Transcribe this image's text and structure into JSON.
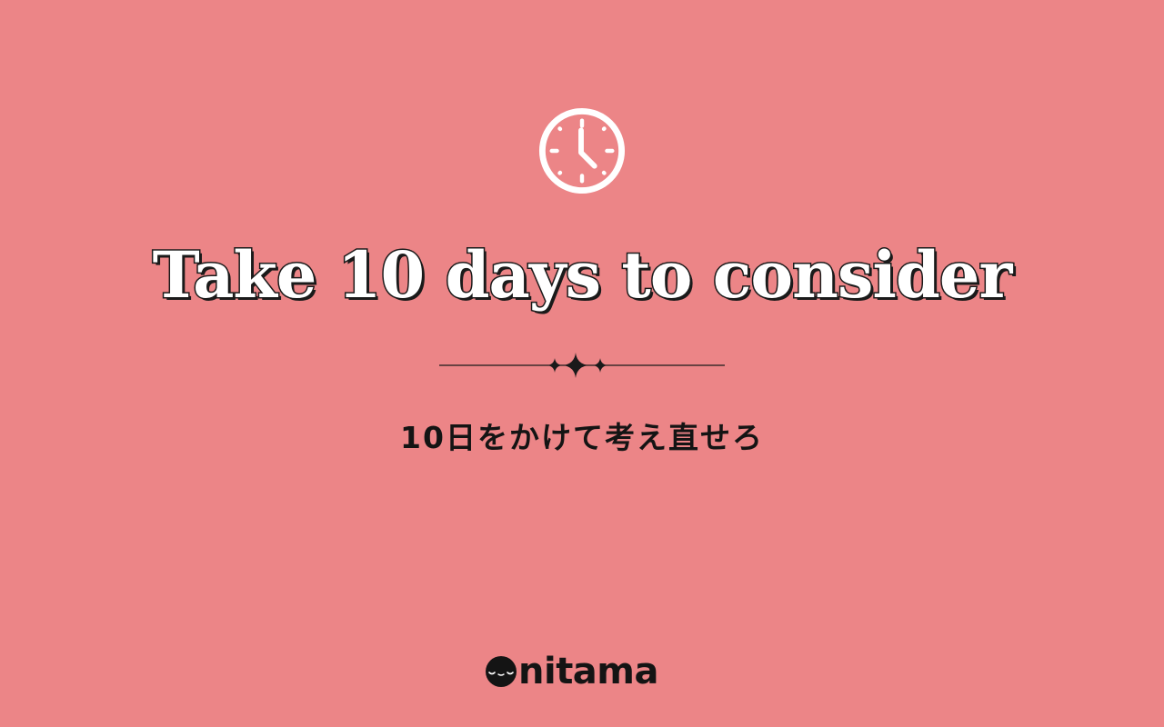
{
  "colors": {
    "background": "#ec8587",
    "title_fill": "#ffffff",
    "outline": "#1a1a1a",
    "text": "#141414"
  },
  "icon": "clock-icon",
  "title": "Take 10 days to consider",
  "subtitle": "10日をかけて考え直せろ",
  "logo": {
    "mark": "egg-face-icon",
    "text": "nitama"
  }
}
